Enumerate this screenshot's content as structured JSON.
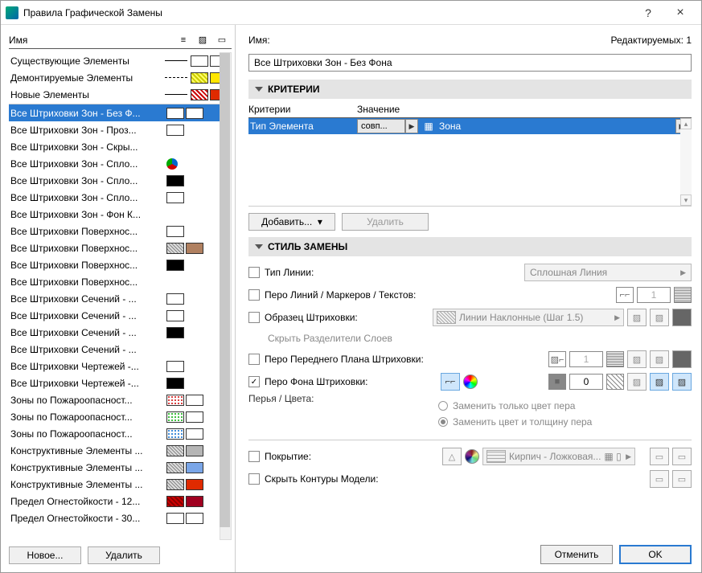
{
  "window": {
    "title": "Правила Графической Замены"
  },
  "left": {
    "header_name": "Имя",
    "new_btn": "Новое...",
    "delete_btn": "Удалить",
    "rules": [
      {
        "name": "Существующие Элементы",
        "line": true,
        "sw1": "#fff",
        "sw2": "#fff"
      },
      {
        "name": "Демонтируемые Элементы",
        "line": "dashed",
        "sw1": "hatch-yellow",
        "sw2": "#ffe600"
      },
      {
        "name": "Новые Элементы",
        "line": true,
        "sw1": "hatch-red",
        "sw2": "#e02a00"
      }
    ],
    "rules2": [
      {
        "name": "Все Штриховки Зон - Без Ф...",
        "sw1": "#fff",
        "sw2": "#fff",
        "selected": true
      },
      {
        "name": "Все Штриховки Зон - Проз...",
        "sw2": "#fff"
      },
      {
        "name": "Все Штриховки Зон - Скры..."
      },
      {
        "name": "Все Штриховки Зон - Спло...",
        "icon": "pie"
      },
      {
        "name": "Все Штриховки Зон - Спло...",
        "sw2": "#000"
      },
      {
        "name": "Все Штриховки Зон - Спло...",
        "sw2": "#fff"
      },
      {
        "name": "Все Штриховки Зон - Фон К..."
      },
      {
        "name": "Все Штриховки Поверхнос...",
        "sw2": "#fff"
      },
      {
        "name": "Все Штриховки Поверхнос...",
        "sw1": "hatch-gray",
        "sw2": "#b08060"
      },
      {
        "name": "Все Штриховки Поверхнос...",
        "sw2": "#000"
      },
      {
        "name": "Все Штриховки Поверхнос..."
      },
      {
        "name": "Все Штриховки Сечений - ...",
        "sw2": "#fff"
      },
      {
        "name": "Все Штриховки Сечений - ...",
        "sw2": "#fff"
      },
      {
        "name": "Все Штриховки Сечений - ...",
        "sw2": "#000"
      },
      {
        "name": "Все Штриховки Сечений - ..."
      },
      {
        "name": "Все Штриховки Чертежей -...",
        "sw2": "#fff"
      },
      {
        "name": "Все Штриховки Чертежей -...",
        "sw2": "#000"
      },
      {
        "name": "Зоны по Пожароопасност...",
        "sw1": "hatch-red-dots",
        "sw2": "#fff"
      },
      {
        "name": "Зоны по Пожароопасност...",
        "sw1": "hatch-green-dots",
        "sw2": "#fff"
      },
      {
        "name": "Зоны по Пожароопасност...",
        "sw1": "hatch-blue-dots",
        "sw2": "#fff"
      },
      {
        "name": "Конструктивные Элементы ...",
        "sw1": "hatch-gray",
        "sw2": "#b5b5b5"
      },
      {
        "name": "Конструктивные Элементы ...",
        "sw1": "hatch-gray",
        "sw2": "#7aa6e8"
      },
      {
        "name": "Конструктивные Элементы ...",
        "sw1": "hatch-gray",
        "sw2": "#e02a00"
      },
      {
        "name": "Предел Огнестойкости - 12...",
        "sw1": "hatch-red-diag",
        "sw2": "#a00020"
      },
      {
        "name": "Предел Огнестойкости - 30...",
        "sw1": "#fff",
        "sw2": "#fff"
      }
    ]
  },
  "right": {
    "name_label": "Имя:",
    "editable_label": "Редактируемых: 1",
    "name_value": "Все Штриховки Зон - Без Фона",
    "criteria_title": "КРИТЕРИИ",
    "criteria_hdr1": "Критерии",
    "criteria_hdr2": "Значение",
    "criteria_row": {
      "prop": "Тип Элемента",
      "op": "совп...",
      "value": "Зона"
    },
    "add_btn": "Добавить...",
    "remove_btn": "Удалить",
    "style_title": "СТИЛЬ ЗАМЕНЫ",
    "linetype_label": "Тип Линии:",
    "linetype_value": "Сплошная Линия",
    "linepen_label": "Перо Линий / Маркеров / Текстов:",
    "linepen_value": "1",
    "fillpat_label": "Образец Штриховки:",
    "fillpat_value": "Линии Наклонные (Шаг 1.5)",
    "hide_sep_label": "Скрыть Разделители Слоев",
    "fg_label": "Перо Переднего Плана Штриховки:",
    "fg_value": "1",
    "bg_label": "Перо Фона Штриховки:",
    "bg_value": "0",
    "radio1": "Заменить только цвет пера",
    "radio2": "Заменить цвет и толщину пера",
    "pens_label": "Перья / Цвета:",
    "surf_label": "Покрытие:",
    "surf_value": "Кирпич - Ложковая...",
    "hide_contours_label": "Скрыть Контуры Модели:",
    "cancel_btn": "Отменить",
    "ok_btn": "OK"
  }
}
